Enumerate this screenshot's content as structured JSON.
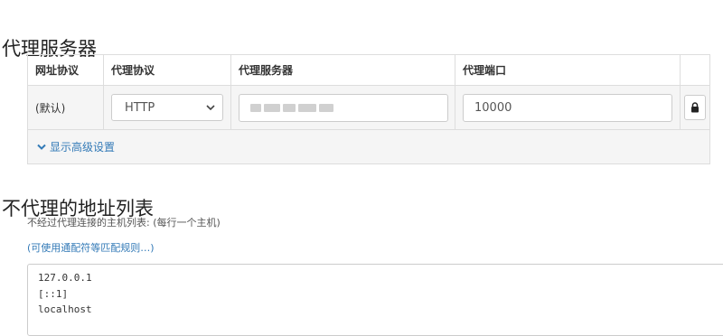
{
  "section_proxy": {
    "title": "代理服务器"
  },
  "table": {
    "headers": [
      "网址协议",
      "代理协议",
      "代理服务器",
      "代理端口"
    ],
    "row": {
      "scheme": "(默认)",
      "protocol": "HTTP",
      "server": "",
      "port": "10000"
    },
    "advanced_label": "显示高级设置"
  },
  "section_bypass": {
    "title": "不代理的地址列表",
    "description": "不经过代理连接的主机列表: (每行一个主机)",
    "help_link": "(可使用通配符等匹配规则…)",
    "list": [
      "127.0.0.1",
      "[::1]",
      "localhost"
    ]
  },
  "colors": {
    "link": "#337ab7",
    "border": "#dddddd",
    "row_bg": "#f5f5f5"
  },
  "icons": {
    "select_arrow": "chevron-down-icon",
    "lock": "lock-icon",
    "advanced": "chevron-down-icon"
  }
}
